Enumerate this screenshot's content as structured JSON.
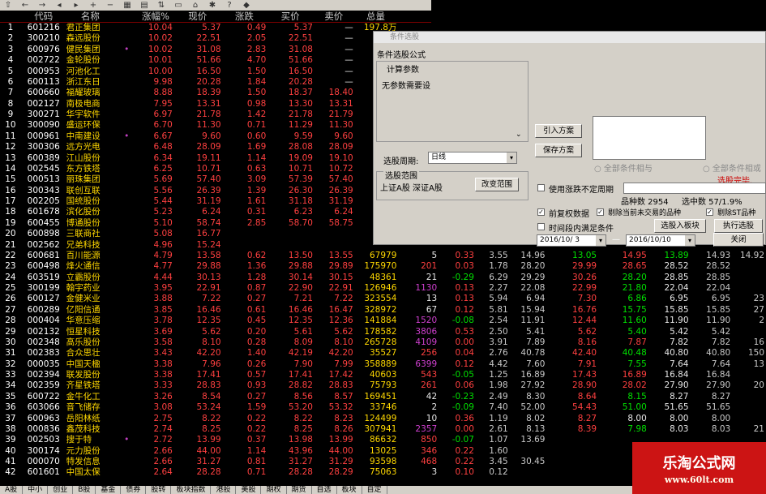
{
  "toolbar": {
    "icons": [
      "up-icon",
      "back-icon",
      "forward-icon",
      "arrow-left-icon",
      "arrow-right-icon",
      "zoom-in-icon",
      "zoom-out-icon",
      "chart-icon",
      "grid-icon",
      "sort-icon",
      "print-icon",
      "home-icon",
      "settings-icon",
      "help-icon",
      "gem-icon"
    ]
  },
  "table": {
    "headers": [
      "",
      "代码",
      "名称",
      "",
      "涨幅%",
      "现价",
      "涨跌",
      "买价",
      "卖价",
      "总量",
      "",
      "",
      "",
      "",
      "",
      "",
      "",
      "",
      ""
    ],
    "rows": [
      [
        "1",
        "601216",
        "君正集团",
        "",
        "10.04",
        "5.37",
        "0.49",
        "5.37",
        "—",
        "197.8万",
        "",
        "",
        "",
        "",
        "",
        "",
        "",
        "",
        ""
      ],
      [
        "2",
        "300210",
        "森远股份",
        "",
        "10.02",
        "22.51",
        "2.05",
        "22.51",
        "—",
        "",
        "",
        "",
        "",
        "",
        "",
        "",
        "",
        "",
        ""
      ],
      [
        "3",
        "600976",
        "健民集团",
        "•",
        "10.02",
        "31.08",
        "2.83",
        "31.08",
        "—",
        "",
        "",
        "",
        "",
        "",
        "",
        "",
        "",
        "",
        ""
      ],
      [
        "4",
        "002722",
        "金轮股份",
        "",
        "10.01",
        "51.66",
        "4.70",
        "51.66",
        "—",
        "",
        "",
        "",
        "",
        "",
        "",
        "",
        "",
        "",
        ""
      ],
      [
        "5",
        "000953",
        "河池化工",
        "",
        "10.00",
        "16.50",
        "1.50",
        "16.50",
        "—",
        "",
        "",
        "",
        "",
        "",
        "",
        "",
        "",
        "",
        ""
      ],
      [
        "6",
        "600113",
        "浙江东日",
        "",
        "9.98",
        "20.28",
        "1.84",
        "20.28",
        "—",
        "",
        "",
        "",
        "",
        "",
        "",
        "",
        "",
        "",
        ""
      ],
      [
        "7",
        "600660",
        "福耀玻璃",
        "",
        "8.88",
        "18.39",
        "1.50",
        "18.37",
        "18.40",
        "",
        "",
        "",
        "",
        "",
        "",
        "",
        "",
        "",
        ""
      ],
      [
        "8",
        "002127",
        "南极电商",
        "",
        "7.95",
        "13.31",
        "0.98",
        "13.30",
        "13.31",
        "",
        "",
        "",
        "",
        "",
        "",
        "",
        "",
        "",
        ""
      ],
      [
        "9",
        "300271",
        "华宇软件",
        "",
        "6.97",
        "21.78",
        "1.42",
        "21.78",
        "21.79",
        "",
        "",
        "",
        "",
        "",
        "",
        "",
        "",
        "",
        ""
      ],
      [
        "10",
        "300090",
        "盛运环保",
        "",
        "6.70",
        "11.30",
        "0.71",
        "11.29",
        "11.30",
        "",
        "",
        "",
        "",
        "",
        "",
        "",
        "",
        "",
        ""
      ],
      [
        "11",
        "000961",
        "中南建设",
        "•",
        "6.67",
        "9.60",
        "0.60",
        "9.59",
        "9.60",
        "",
        "",
        "",
        "",
        "",
        "",
        "",
        "",
        "",
        ""
      ],
      [
        "12",
        "300306",
        "远方光电",
        "",
        "6.48",
        "28.09",
        "1.69",
        "28.08",
        "28.09",
        "",
        "",
        "",
        "",
        "",
        "",
        "",
        "",
        "",
        ""
      ],
      [
        "13",
        "600389",
        "江山股份",
        "",
        "6.34",
        "19.11",
        "1.14",
        "19.09",
        "19.10",
        "",
        "",
        "",
        "",
        "",
        "",
        "",
        "",
        "",
        ""
      ],
      [
        "14",
        "002545",
        "东方铁塔",
        "",
        "6.25",
        "10.71",
        "0.63",
        "10.71",
        "10.72",
        "",
        "",
        "",
        "",
        "",
        "",
        "",
        "",
        "",
        ""
      ],
      [
        "15",
        "000513",
        "丽珠集团",
        "",
        "5.69",
        "57.40",
        "3.09",
        "57.39",
        "57.40",
        "",
        "",
        "",
        "",
        "",
        "",
        "",
        "",
        "",
        ""
      ],
      [
        "16",
        "300343",
        "联创互联",
        "",
        "5.56",
        "26.39",
        "1.39",
        "26.30",
        "26.39",
        "",
        "",
        "",
        "",
        "",
        "",
        "",
        "",
        "",
        ""
      ],
      [
        "17",
        "002205",
        "国统股份",
        "",
        "5.44",
        "31.19",
        "1.61",
        "31.18",
        "31.19",
        "",
        "",
        "",
        "",
        "",
        "",
        "",
        "",
        "",
        ""
      ],
      [
        "18",
        "601678",
        "滨化股份",
        "",
        "5.23",
        "6.24",
        "0.31",
        "6.23",
        "6.24",
        "",
        "",
        "",
        "",
        "",
        "",
        "",
        "",
        "",
        ""
      ],
      [
        "19",
        "600455",
        "博通股份",
        "",
        "5.10",
        "58.74",
        "2.85",
        "58.70",
        "58.75",
        "",
        "",
        "",
        "",
        "",
        "",
        "",
        "",
        "",
        ""
      ],
      [
        "20",
        "600898",
        "三联商社",
        "",
        "5.08",
        "16.77",
        "",
        "",
        "",
        "",
        "",
        "",
        "",
        "",
        "",
        "",
        "",
        "",
        ""
      ],
      [
        "21",
        "002562",
        "兄弟科技",
        "",
        "4.96",
        "15.24",
        "",
        "",
        "",
        "",
        "",
        "",
        "",
        "",
        "",
        "",
        "",
        "",
        ""
      ],
      [
        "22",
        "600681",
        "百川能源",
        "",
        "4.79",
        "13.58",
        "0.62",
        "13.50",
        "13.55",
        "67979",
        "5",
        "0.33",
        "3.55",
        "14.96",
        "13.05",
        "14.95",
        "13.89",
        "14.93",
        "14.92"
      ],
      [
        "23",
        "600498",
        "烽火通信",
        "",
        "4.77",
        "29.88",
        "1.36",
        "29.88",
        "29.89",
        "175970",
        "201",
        "0.03",
        "1.78",
        "28.20",
        "29.99",
        "28.65",
        "28.52",
        "28.52",
        ""
      ],
      [
        "24",
        "603519",
        "立霸股份",
        "",
        "4.44",
        "30.13",
        "1.28",
        "30.14",
        "30.15",
        "48361",
        "21",
        "-0.29",
        "6.29",
        "29.29",
        "30.26",
        "28.20",
        "28.85",
        "28.85",
        ""
      ],
      [
        "25",
        "300199",
        "翰宇药业",
        "",
        "3.95",
        "22.91",
        "0.87",
        "22.90",
        "22.91",
        "126946",
        "1130",
        "0.13",
        "2.27",
        "22.08",
        "22.99",
        "21.80",
        "22.04",
        "22.04",
        ""
      ],
      [
        "26",
        "600127",
        "金健米业",
        "",
        "3.88",
        "7.22",
        "0.27",
        "7.21",
        "7.22",
        "323554",
        "13",
        "0.13",
        "5.94",
        "6.94",
        "7.30",
        "6.86",
        "6.95",
        "6.95",
        "23"
      ],
      [
        "27",
        "600289",
        "亿阳信通",
        "",
        "3.85",
        "16.46",
        "0.61",
        "16.46",
        "16.47",
        "328972",
        "67",
        "0.12",
        "5.81",
        "15.94",
        "16.76",
        "15.75",
        "15.85",
        "15.85",
        "27"
      ],
      [
        "28",
        "000404",
        "华意压缩",
        "",
        "3.78",
        "12.35",
        "0.45",
        "12.35",
        "12.36",
        "141884",
        "1520",
        "-0.08",
        "2.54",
        "11.91",
        "12.44",
        "11.60",
        "11.90",
        "11.90",
        "2"
      ],
      [
        "29",
        "002132",
        "恒星科技",
        "",
        "3.69",
        "5.62",
        "0.20",
        "5.61",
        "5.62",
        "178582",
        "3806",
        "0.53",
        "2.50",
        "5.41",
        "5.62",
        "5.40",
        "5.42",
        "5.42",
        ""
      ],
      [
        "30",
        "002348",
        "高乐股份",
        "",
        "3.58",
        "8.10",
        "0.28",
        "8.09",
        "8.10",
        "265728",
        "4109",
        "0.00",
        "3.91",
        "7.89",
        "8.16",
        "7.87",
        "7.82",
        "7.82",
        "16"
      ],
      [
        "31",
        "002383",
        "合众思壮",
        "",
        "3.43",
        "42.20",
        "1.40",
        "42.19",
        "42.20",
        "35527",
        "256",
        "0.04",
        "2.76",
        "40.78",
        "42.40",
        "40.48",
        "40.80",
        "40.80",
        "150"
      ],
      [
        "32",
        "000035",
        "中国天楹",
        "",
        "3.38",
        "7.96",
        "0.26",
        "7.90",
        "7.99",
        "358889",
        "6399",
        "0.12",
        "4.42",
        "7.60",
        "7.91",
        "7.55",
        "7.64",
        "7.64",
        "13"
      ],
      [
        "33",
        "002394",
        "联发股份",
        "",
        "3.38",
        "17.41",
        "0.57",
        "17.41",
        "17.42",
        "40603",
        "543",
        "-0.05",
        "1.25",
        "16.89",
        "17.43",
        "16.89",
        "16.84",
        "16.84",
        ""
      ],
      [
        "34",
        "002359",
        "齐星铁塔",
        "",
        "3.33",
        "28.83",
        "0.93",
        "28.82",
        "28.83",
        "75793",
        "261",
        "0.06",
        "1.98",
        "27.92",
        "28.90",
        "28.02",
        "27.90",
        "27.90",
        "20"
      ],
      [
        "35",
        "600722",
        "金牛化工",
        "",
        "3.26",
        "8.54",
        "0.27",
        "8.56",
        "8.57",
        "169451",
        "42",
        "-0.23",
        "2.49",
        "8.30",
        "8.64",
        "8.15",
        "8.27",
        "8.27",
        ""
      ],
      [
        "36",
        "603066",
        "音飞储存",
        "",
        "3.08",
        "53.24",
        "1.59",
        "53.20",
        "53.32",
        "33746",
        "2",
        "-0.09",
        "7.40",
        "52.00",
        "54.43",
        "51.00",
        "51.65",
        "51.65",
        ""
      ],
      [
        "37",
        "600963",
        "岳阳林纸",
        "",
        "2.75",
        "8.22",
        "0.22",
        "8.22",
        "8.23",
        "124499",
        "10",
        "0.36",
        "1.19",
        "8.02",
        "8.27",
        "8.00",
        "8.00",
        "8.00",
        ""
      ],
      [
        "38",
        "000836",
        "鑫茂科技",
        "",
        "2.74",
        "8.25",
        "0.22",
        "8.25",
        "8.26",
        "307941",
        "2357",
        "0.00",
        "2.61",
        "8.13",
        "8.39",
        "7.98",
        "8.03",
        "8.03",
        "21"
      ],
      [
        "39",
        "002503",
        "搜于特",
        "•",
        "2.72",
        "13.99",
        "0.37",
        "13.98",
        "13.99",
        "86632",
        "850",
        "-0.07",
        "1.07",
        "13.69",
        "",
        "",
        "",
        "",
        ""
      ],
      [
        "40",
        "300174",
        "元力股份",
        "",
        "2.66",
        "44.00",
        "1.14",
        "43.96",
        "44.00",
        "13025",
        "346",
        "0.22",
        "1.60",
        "",
        "",
        "",
        "",
        "",
        ""
      ],
      [
        "41",
        "000070",
        "特发信息",
        "",
        "2.66",
        "31.27",
        "0.81",
        "31.27",
        "31.29",
        "93598",
        "468",
        "0.22",
        "3.45",
        "30.45",
        "",
        "",
        "",
        "",
        ""
      ],
      [
        "42",
        "601601",
        "中国太保",
        "",
        "2.64",
        "28.28",
        "0.71",
        "28.28",
        "28.29",
        "75063",
        "3",
        "0.10",
        "0.12",
        "",
        "",
        "",
        "",
        "",
        ""
      ]
    ]
  },
  "dialog": {
    "title": "条件选股",
    "formula_label": "条件选股公式",
    "params_group": "计算参数",
    "params_note": "无参数需要设",
    "import_btn": "引入方案",
    "save_btn": "保存方案",
    "period_label": "选股周期:",
    "period_value": "日线",
    "range_group": "选股范围",
    "range_value": "上证A股 深证A股",
    "change_range_btn": "改变范围",
    "radio_and": "全部条件相与",
    "radio_or": "全部条件相或",
    "status": "选股完毕.",
    "chk_unsure": "使用涨跌不定周期",
    "count_label": "品种数 2954",
    "selected_label": "选中数 57/1.9%",
    "chk_adj": "前复权数据",
    "chk_excl_untraded": "剔除当前未交易的品种",
    "chk_excl_st": "剔除ST品种",
    "chk_period": "时间段内满足条件",
    "add_board_btn": "选股入板块",
    "run_btn": "执行选股",
    "date_from": "2016/10/ 3",
    "date_to": "2016/10/10",
    "close_btn": "关闭"
  },
  "tabs": [
    "A股",
    "中小",
    "创业",
    "B股",
    "基金",
    "债券",
    "股转",
    "板块指数",
    "港股",
    "美股",
    "期权",
    "期货",
    "自选",
    "板块",
    "自定"
  ],
  "watermark": {
    "logo": "乐淘公式网",
    "url": "www.60lt.com"
  }
}
